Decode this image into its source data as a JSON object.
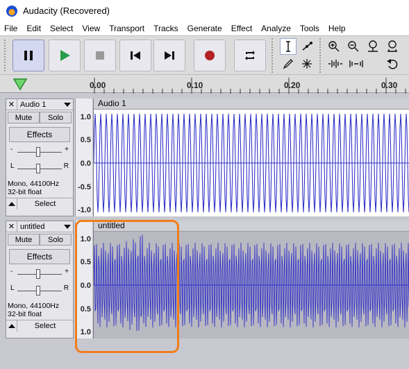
{
  "window": {
    "title": "Audacity (Recovered)"
  },
  "menu": [
    "File",
    "Edit",
    "Select",
    "View",
    "Transport",
    "Tracks",
    "Generate",
    "Effect",
    "Analyze",
    "Tools",
    "Help"
  ],
  "transport": {
    "buttons": [
      "pause-icon",
      "play-icon",
      "stop-icon",
      "skip-start-icon",
      "skip-end-icon",
      "record-icon",
      "loop-icon"
    ],
    "colors": {
      "play": "#2a9d4a",
      "record": "#b22222"
    }
  },
  "tools": [
    "selection-tool-icon",
    "envelope-tool-icon",
    "draw-tool-icon",
    "multi-tool-icon",
    "zoom-in-icon",
    "zoom-out-icon",
    "fit-selection-icon",
    "fit-project-icon",
    "trim-icon",
    "silence-icon",
    "undo-icon"
  ],
  "ruler": {
    "labels": [
      "0.00",
      "0.10",
      "0.20",
      "0.30"
    ]
  },
  "tracks": [
    {
      "name": "Audio 1",
      "clip_name": "Audio 1",
      "mute": "Mute",
      "solo": "Solo",
      "effects": "Effects",
      "gain_minus": "-",
      "gain_plus": "+",
      "pan_left": "L",
      "pan_right": "R",
      "gain": 0.5,
      "pan": 0.5,
      "info_line1": "Mono, 44100Hz",
      "info_line2": "32-bit float",
      "select": "Select",
      "scale": [
        "1.0",
        "0.5",
        "0.0",
        "-0.5",
        "-1.0"
      ]
    },
    {
      "name": "untitled",
      "clip_name": "untitled",
      "mute": "Mute",
      "solo": "Solo",
      "effects": "Effects",
      "gain_minus": "-",
      "gain_plus": "+",
      "pan_left": "L",
      "pan_right": "R",
      "gain": 0.5,
      "pan": 0.5,
      "info_line1": "Mono, 44100Hz",
      "info_line2": "32-bit float",
      "select": "Select",
      "scale": [
        "1.0",
        "0.5",
        "0.0",
        "0.5",
        "1.0"
      ]
    }
  ],
  "colors": {
    "waveform": "#3232c8",
    "highlight": "#f07d1a"
  }
}
